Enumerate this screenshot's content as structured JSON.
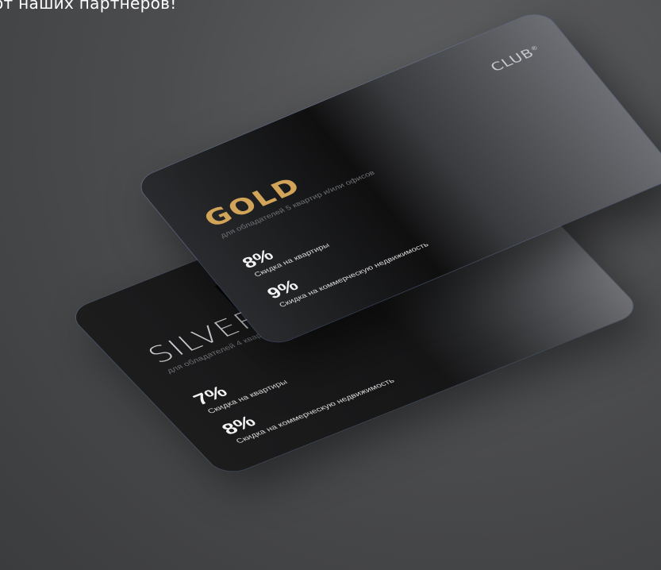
{
  "header_text": "от наших партнеров!",
  "silver_card": {
    "title": "SILVER+",
    "subtitle": "для обладателей 4 квартир и/или офисов",
    "offers": [
      {
        "value": "7%",
        "label": "Скидка на квартиры"
      },
      {
        "value": "8%",
        "label": "Скидка на коммерческую недвижимость"
      }
    ]
  },
  "gold_card": {
    "title": "GOLD",
    "subtitle": "для обладателей 5 квартир и/или офисов",
    "logo": "CLUB",
    "logo_mark": "®",
    "offers": [
      {
        "value": "8%",
        "label": "Скидка на квартиры"
      },
      {
        "value": "9%",
        "label": "Скидка на коммерческую недвижимость"
      }
    ]
  },
  "colors": {
    "background": "#4c4d4f",
    "gold_accent": "#d2a45a",
    "card_dark": "#161617"
  }
}
